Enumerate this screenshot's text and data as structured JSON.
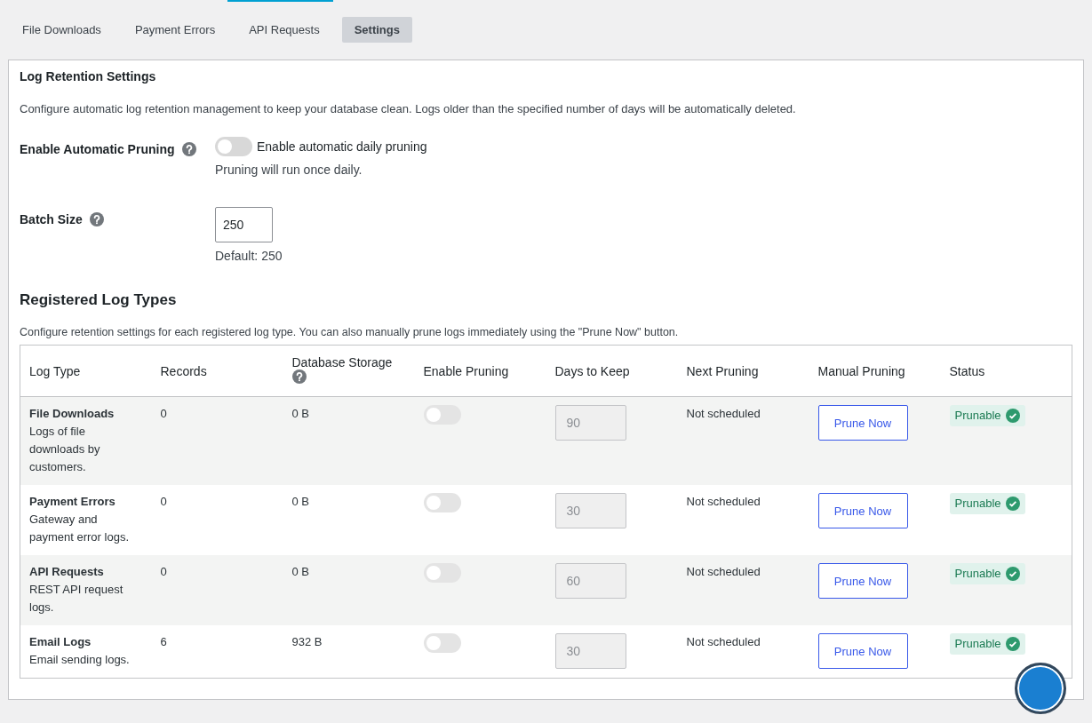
{
  "tabs": [
    {
      "label": "File Downloads",
      "selected": false
    },
    {
      "label": "Payment Errors",
      "selected": false
    },
    {
      "label": "API Requests",
      "selected": false
    },
    {
      "label": "Settings",
      "selected": true
    }
  ],
  "retention": {
    "title": "Log Retention Settings",
    "description": "Configure automatic log retention management to keep your database clean. Logs older than the specified number of days will be automatically deleted.",
    "fields": [
      {
        "kind": "toggle",
        "label": "Enable Automatic Pruning",
        "on": false,
        "toggle_label": "Enable automatic daily pruning",
        "hint": "Pruning will run once daily."
      },
      {
        "kind": "number",
        "label": "Batch Size",
        "value": "250",
        "hint": "Default: 250"
      }
    ]
  },
  "log_types": {
    "title": "Registered Log Types",
    "description": "Configure retention settings for each registered log type. You can also manually prune logs immediately using the \"Prune Now\" button.",
    "columns": [
      {
        "label": "Log Type"
      },
      {
        "label": "Records"
      },
      {
        "label": "Database Storage",
        "help": true
      },
      {
        "label": "Enable Pruning"
      },
      {
        "label": "Days to Keep"
      },
      {
        "label": "Next Pruning"
      },
      {
        "label": "Manual Pruning"
      },
      {
        "label": "Status"
      }
    ],
    "rows": [
      {
        "name": "File Downloads",
        "description": "Logs of file downloads by customers.",
        "records": "0",
        "storage": "0 B",
        "pruning_on": false,
        "days": "90",
        "days_disabled": true,
        "next": "Not scheduled",
        "action": "Prune Now",
        "status": "Prunable",
        "status_ok": true
      },
      {
        "name": "Payment Errors",
        "description": "Gateway and payment error logs.",
        "records": "0",
        "storage": "0 B",
        "pruning_on": false,
        "days": "30",
        "days_disabled": true,
        "next": "Not scheduled",
        "action": "Prune Now",
        "status": "Prunable",
        "status_ok": true
      },
      {
        "name": "API Requests",
        "description": "REST API request logs.",
        "records": "0",
        "storage": "0 B",
        "pruning_on": false,
        "days": "60",
        "days_disabled": true,
        "next": "Not scheduled",
        "action": "Prune Now",
        "status": "Prunable",
        "status_ok": true
      },
      {
        "name": "Email Logs",
        "description": "Email sending logs.",
        "records": "6",
        "storage": "932 B",
        "pruning_on": false,
        "days": "30",
        "days_disabled": true,
        "next": "Not scheduled",
        "action": "Prune Now",
        "status": "Prunable",
        "status_ok": true
      }
    ]
  }
}
